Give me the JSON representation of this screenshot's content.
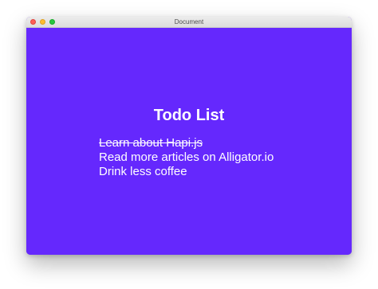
{
  "window": {
    "title": "Document"
  },
  "page": {
    "heading": "Todo List",
    "background_color": "#6528fd",
    "todos": [
      {
        "text": "Learn about Hapi.js",
        "completed": true
      },
      {
        "text": "Read more articles on Alligator.io",
        "completed": false
      },
      {
        "text": "Drink less coffee",
        "completed": false
      }
    ]
  }
}
